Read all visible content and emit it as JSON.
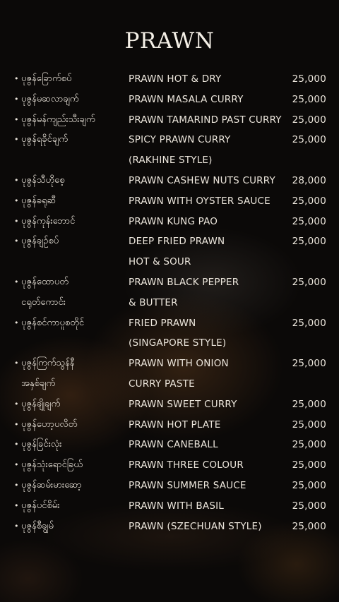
{
  "title": "PRAWN",
  "items": [
    {
      "bullet": "•",
      "mm": "ပုဇွန်ခြောက်စပ်",
      "en": "PRAWN HOT & DRY",
      "price": "25,000"
    },
    {
      "bullet": "•",
      "mm": "ပုဇွန်မဆလာချက်",
      "en": "PRAWN MASALA CURRY",
      "price": "25,000"
    },
    {
      "bullet": "•",
      "mm": "ပုဇွန်မန်ကျည်းသီးချက်",
      "en": "PRAWN TAMARIND PAST CURRY",
      "price": "25,000"
    },
    {
      "bullet": "•",
      "mm": "ပုဇွန်ရခိုင်ချက်",
      "en": "SPICY PRAWN CURRY",
      "price": "25,000"
    },
    {
      "bullet": "",
      "mm": "",
      "en": "(RAKHINE STYLE)",
      "price": ""
    },
    {
      "bullet": "•",
      "mm": "ပုဇွန်သီဟိုစေ့",
      "en": "PRAWN CASHEW NUTS CURRY",
      "price": "28,000"
    },
    {
      "bullet": "•",
      "mm": "ပုဇွန်ခရုဆီ",
      "en": "PRAWN WITH OYSTER SAUCE",
      "price": "25,000"
    },
    {
      "bullet": "•",
      "mm": "ပုဇွန်ကုန်းဘောင်",
      "en": "PRAWN KUNG PAO",
      "price": "25,000"
    },
    {
      "bullet": "•",
      "mm": "ပုဇွန်ချဉ်စပ်",
      "en": "DEEP FRIED PRAWN",
      "price": "25,000"
    },
    {
      "bullet": "",
      "mm": "",
      "en": "HOT & SOUR",
      "price": ""
    },
    {
      "bullet": "•",
      "mm": "ပုဇွန်ထောပတ်",
      "en": "PRAWN BLACK PEPPER",
      "price": "25,000"
    },
    {
      "bullet": "",
      "mm": "ငရုတ်ကောင်း",
      "en": "& BUTTER",
      "price": ""
    },
    {
      "bullet": "•",
      "mm": "ပုဇွန်စင်ကာပူစတိုင်",
      "en": "FRIED PRAWN",
      "price": "25,000"
    },
    {
      "bullet": "",
      "mm": "",
      "en": "(SINGAPORE STYLE)",
      "price": ""
    },
    {
      "bullet": "•",
      "mm": "ပုဇွန်ကြက်သွန်နီ",
      "en": "PRAWN WITH ONION",
      "price": "25,000"
    },
    {
      "bullet": "",
      "mm": "အနှစ်ချက်",
      "en": "CURRY PASTE",
      "price": ""
    },
    {
      "bullet": "•",
      "mm": "ပုဇွန်ချိုချက်",
      "en": "PRAWN SWEET CURRY",
      "price": "25,000"
    },
    {
      "bullet": "•",
      "mm": "ပုဇွန်ဟော့ပလိတ်",
      "en": "PRAWN HOT PLATE",
      "price": "25,000"
    },
    {
      "bullet": "•",
      "mm": "ပုဇွန်ခြင်းလုံး",
      "en": "PRAWN CANEBALL",
      "price": "25,000"
    },
    {
      "bullet": "•",
      "mm": "ပုဇွန်သုံးရောင်ခြယ်",
      "en": "PRAWN THREE COLOUR",
      "price": "25,000"
    },
    {
      "bullet": "•",
      "mm": "ပုဇွန်ဆမ်းမားဆော့",
      "en": "PRAWN SUMMER SAUCE",
      "price": "25,000"
    },
    {
      "bullet": "•",
      "mm": "ပုဇွန်ပင်စိမ်း",
      "en": "PRAWN WITH BASIL",
      "price": "25,000"
    },
    {
      "bullet": "•",
      "mm": "ပုဇွန်စီချွမ်",
      "en": "PRAWN (SZECHUAN STYLE)",
      "price": "25,000"
    }
  ]
}
